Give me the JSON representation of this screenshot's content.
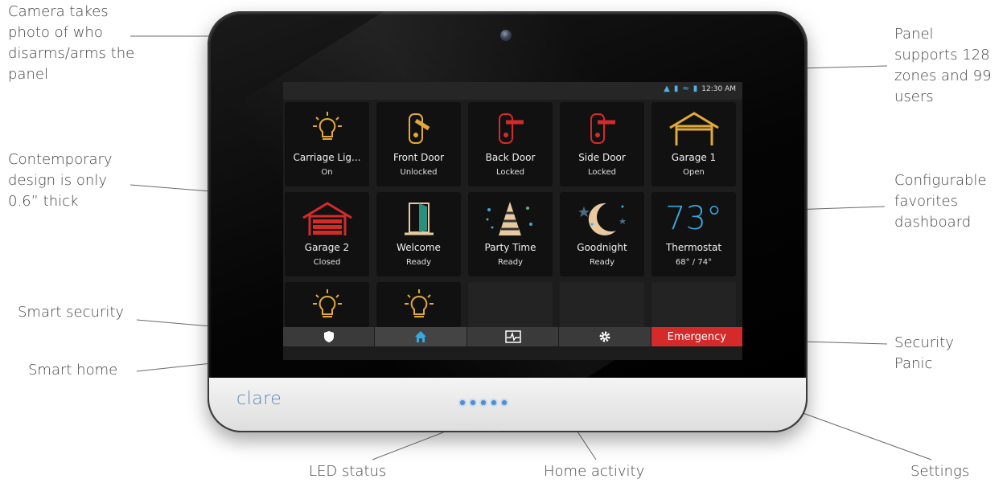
{
  "callouts": {
    "camera": [
      "Camera takes",
      "photo of who",
      "disarms/arms the",
      "panel"
    ],
    "design": [
      "Contemporary",
      "design is only",
      "0.6” thick"
    ],
    "smart_security": [
      "Smart security"
    ],
    "smart_home": [
      "Smart home"
    ],
    "panel_capacity": [
      "Panel",
      "supports 128",
      "zones and 99",
      "users"
    ],
    "favorites": [
      "Configurable",
      "favorites",
      "dashboard"
    ],
    "panic": [
      "Security",
      "Panic"
    ],
    "led": [
      "LED status"
    ],
    "activity": [
      "Home activity"
    ],
    "settings": [
      "Settings"
    ]
  },
  "device": {
    "brand": "clare"
  },
  "status_bar": {
    "time": "12:30 AM"
  },
  "tiles": [
    {
      "name": "Carriage Lig...",
      "state": "On",
      "icon": "bulb-icon"
    },
    {
      "name": "Front Door",
      "state": "Unlocked",
      "icon": "lock-unlocked-icon"
    },
    {
      "name": "Back Door",
      "state": "Locked",
      "icon": "lock-locked-icon"
    },
    {
      "name": "Side Door",
      "state": "Locked",
      "icon": "lock-locked-icon"
    },
    {
      "name": "Garage 1",
      "state": "Open",
      "icon": "garage-open-icon"
    },
    {
      "name": "Garage 2",
      "state": "Closed",
      "icon": "garage-closed-icon"
    },
    {
      "name": "Welcome",
      "state": "Ready",
      "icon": "door-icon"
    },
    {
      "name": "Party Time",
      "state": "Ready",
      "icon": "party-hat-icon"
    },
    {
      "name": "Goodnight",
      "state": "Ready",
      "icon": "moon-icon"
    },
    {
      "name": "Thermostat",
      "state": "68° / 74°",
      "big": "73°"
    }
  ],
  "nav": {
    "emergency_label": "Emergency"
  },
  "colors": {
    "gold": "#e0a93a",
    "red": "#d42a2a",
    "blue": "#3aa8e0",
    "led_blue": "#4c8fd6",
    "brand_blue": "#5e87b5"
  }
}
